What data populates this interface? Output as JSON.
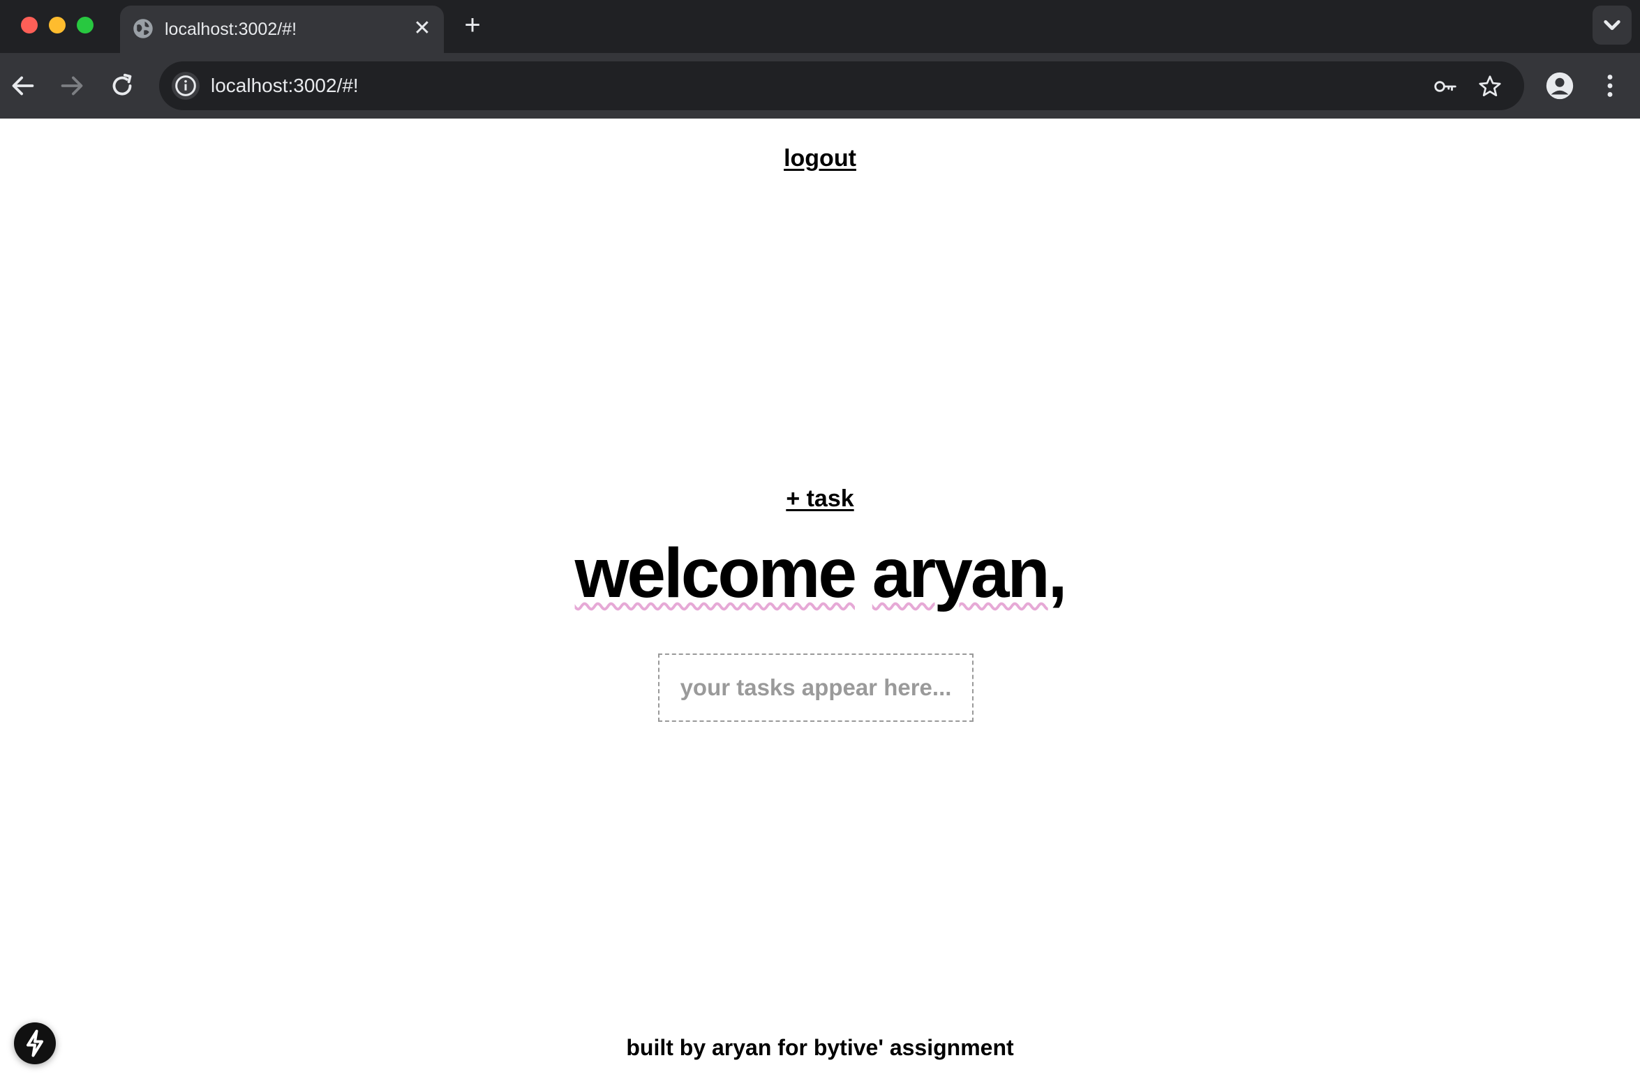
{
  "browser": {
    "tab_title": "localhost:3002/#!",
    "tab_close_glyph": "✕",
    "new_tab_glyph": "+",
    "url": "localhost:3002/#!",
    "icons": [
      "globe-icon",
      "back-arrow-icon",
      "forward-arrow-icon",
      "reload-icon",
      "info-icon",
      "key-icon",
      "star-icon",
      "profile-icon",
      "more-vert-icon",
      "chevron-down-icon"
    ]
  },
  "page": {
    "logout_label": "logout",
    "add_task_label": "+ task",
    "welcome_word": "welcome",
    "welcome_name": "aryan",
    "welcome_punct": ",",
    "tasks_placeholder": "your tasks appear here...",
    "footer_text": "built by aryan for bytive' assignment"
  },
  "colors": {
    "chrome_dark": "#202124",
    "chrome_mid": "#35363a",
    "spell_underline": "#e6a9d6",
    "placeholder_text": "#9a9a9a"
  }
}
